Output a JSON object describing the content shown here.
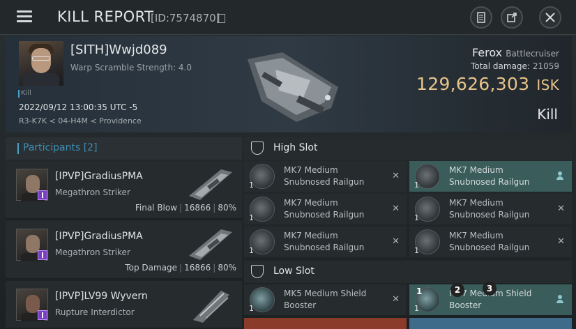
{
  "window": {
    "title": "KILL REPORT",
    "report_id": "[ID:7574870]"
  },
  "victim": {
    "name": "[SITH]Wwjd089",
    "warp_scramble": "Warp Scramble Strength: 4.0",
    "tag": "Kill",
    "datetime": "2022/09/12 13:00:35 UTC -5",
    "location": "R3-K7K < 04-H4M < Providence",
    "ship": "Ferox",
    "ship_class": "Battlecruiser",
    "total_damage_label": "Total damage:",
    "total_damage": "21059",
    "isk_value": "129,626,303",
    "isk_unit": "ISK",
    "result": "Kill"
  },
  "participants": {
    "label": "Participants",
    "count": "[2]",
    "items": [
      {
        "name": "[IPVP]GradiusPMA",
        "ship": "Megathron Striker",
        "role": "Final Blow",
        "damage": "16866",
        "percent": "80%"
      },
      {
        "name": "[IPVP]GradiusPMA",
        "ship": "Megathron Striker",
        "role": "Top Damage",
        "damage": "16866",
        "percent": "80%"
      },
      {
        "name": "[IPVP]LV99 Wyvern",
        "ship": "Rupture Interdictor",
        "role": "",
        "damage": "",
        "percent": ""
      }
    ]
  },
  "high_slot": {
    "label": "High Slot",
    "modules": [
      {
        "qty": "1",
        "name1": "MK7 Medium",
        "name2": "Snubnosed Railgun"
      },
      {
        "qty": "1",
        "name1": "MK7 Medium",
        "name2": "Snubnosed Railgun"
      },
      {
        "qty": "1",
        "name1": "MK7 Medium",
        "name2": "Snubnosed Railgun"
      },
      {
        "qty": "1",
        "name1": "MK7 Medium",
        "name2": "Snubnosed Railgun"
      },
      {
        "qty": "1",
        "name1": "MK7 Medium",
        "name2": "Snubnosed Railgun"
      },
      {
        "qty": "1",
        "name1": "MK7 Medium",
        "name2": "Snubnosed Railgun"
      }
    ]
  },
  "low_slot": {
    "label": "Low Slot",
    "modules": [
      {
        "qty": "1",
        "name1": "MK5 Medium Shield",
        "name2": "Booster"
      },
      {
        "qty": "1",
        "name1": "MK7 Medium Shield",
        "name2": "Booster"
      }
    ]
  },
  "overlay_numbers": [
    "1",
    "2",
    "3"
  ],
  "colors": {
    "accent": "#4aa3c8",
    "isk": "#e8c48a",
    "highlight": "#3a5c5a"
  }
}
